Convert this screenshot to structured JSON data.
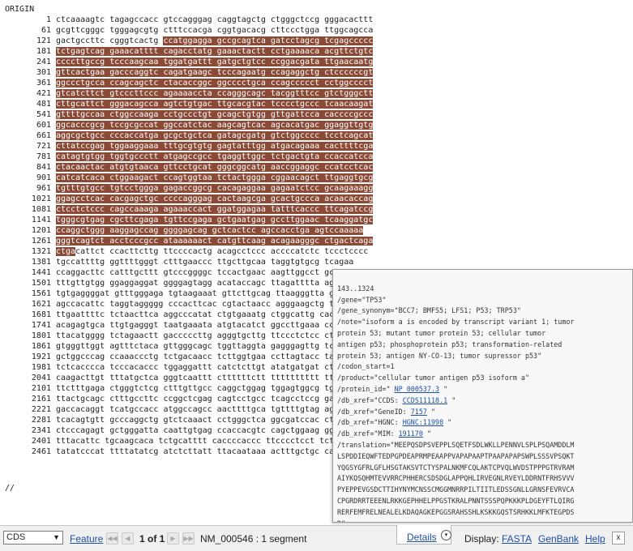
{
  "origin_label": "ORIGIN",
  "end_marker": "//",
  "sequence_lines": [
    {
      "num": "1",
      "text": "ctcaaaagtc tagagccacc gtccagggag caggtagctg ctgggctccg gggacacttt",
      "hl_start": -1,
      "hl_end": 0
    },
    {
      "num": "61",
      "text": "gcgttcgggc tgggagcgtg ctttccacga cggtgacacg cttccctgga ttggcagcca",
      "hl_start": -1,
      "hl_end": 0
    },
    {
      "num": "121",
      "text": "gactgccttc cgggtcactg ccatggagga gccgcagtca gatcctagcg tcgagccccc",
      "hl_start": 22,
      "hl_end": 65
    },
    {
      "num": "181",
      "text": "tctgagtcag gaaacatttt cagacctatg gaaactactt cctgaaaaca acgttctgtc",
      "hl_start": 0,
      "hl_end": 65
    },
    {
      "num": "241",
      "text": "ccccttgccg tcccaagcaa tggatgattt gatgctgtcc ccggacgata ttgaacaatg",
      "hl_start": 0,
      "hl_end": 65
    },
    {
      "num": "301",
      "text": "gttcactgaa gacccaggtc cagatgaagc tcccagaatg ccagaggctg ctccccccgt",
      "hl_start": 0,
      "hl_end": 65
    },
    {
      "num": "361",
      "text": "ggccctgcca ccagcagctc ctacaccggc ggcccctgca ccagccccct cctggcccct",
      "hl_start": 0,
      "hl_end": 65
    },
    {
      "num": "421",
      "text": "gtcatcttct gtcccttccc agaaaaccta ccagggcagc tacggtttcc gtctgggctt",
      "hl_start": 0,
      "hl_end": 65
    },
    {
      "num": "481",
      "text": "cttgcattct gggacagcca agtctgtgac ttgcacgtac tcccctgccc tcaacaagat",
      "hl_start": 0,
      "hl_end": 65
    },
    {
      "num": "541",
      "text": "gttttgccaa ctggccaaga cctgccctgt gcagctgtgg gttgattcca caccccgccc",
      "hl_start": 0,
      "hl_end": 65
    },
    {
      "num": "601",
      "text": "ggcacccgcg tccgcgccat ggccatctac aagcagtcac agcacatgac ggaggttgtg",
      "hl_start": 0,
      "hl_end": 65
    },
    {
      "num": "661",
      "text": "aggcgctgcc cccaccatga gcgctgctca gatagcgatg gtctggcccc tcctcagcat",
      "hl_start": 0,
      "hl_end": 65
    },
    {
      "num": "721",
      "text": "cttatccgag tggaaggaaa tttgcgtgtg gagtatttgg atgacagaaa cacttttcga",
      "hl_start": 0,
      "hl_end": 65
    },
    {
      "num": "781",
      "text": "catagtgtgg tggtgccctt atgagccgcc tgaggttggc tctgactgta ccaccatcca",
      "hl_start": 0,
      "hl_end": 65
    },
    {
      "num": "841",
      "text": "ctacaactac atgtgtaaca gttcctgcat gggcggcatg aaccggaggc ccatcctcac",
      "hl_start": 0,
      "hl_end": 65
    },
    {
      "num": "901",
      "text": "catcatcaca ctggaagact ccagtggtaa tctactggga cggaacagct ttgaggtgcg",
      "hl_start": 0,
      "hl_end": 65
    },
    {
      "num": "961",
      "text": "tgtttgtgcc tgtcctggga gagaccggcg cacagaggaa gagaatctcc gcaagaaagg",
      "hl_start": 0,
      "hl_end": 65
    },
    {
      "num": "1021",
      "text": "ggagcctcac cacgagctgc ccccagggag cactaagcga gcactgccca acaacaccag",
      "hl_start": 0,
      "hl_end": 65
    },
    {
      "num": "1081",
      "text": "ctcctctccc cagccaaaga agaaaccact ggatggagaa tatttcaccc ttcagatccg",
      "hl_start": 0,
      "hl_end": 65
    },
    {
      "num": "1141",
      "text": "tgggcgtgag cgcttcgaga tgttccgaga gctgaatgag gccttggaac tcaaggatgc",
      "hl_start": 0,
      "hl_end": 65
    },
    {
      "num": "1201",
      "text": "ccaggctggg aaggagccag ggggagcag gctcactcc agccacctga agtccaaaaa",
      "hl_start": 0,
      "hl_end": 65
    },
    {
      "num": "1261",
      "text": "gggtcagtct acctcccgcc ataaaaaact catgttcaag acagaagggc ctgactcaga",
      "hl_start": 0,
      "hl_end": 65
    },
    {
      "num": "1321",
      "text": "ctgacattct ccacttcttg ttccccactg acagcctccc accccatctc tccctcccc",
      "hl_start": 0,
      "hl_end": 4
    },
    {
      "num": "1381",
      "text": "tgccattttg ggttttgggt ctttgaaccc ttgcttgcaa taggtgtgcg tcagaa",
      "hl_start": -1,
      "hl_end": 0
    },
    {
      "num": "1441",
      "text": "ccaggacttc catttgcttt gtcccggggc tccactgaac aagttggcct gcactg",
      "hl_start": -1,
      "hl_end": 0
    },
    {
      "num": "1501",
      "text": "tttgttgtgg ggaggaggat ggggagtagg acataccagc ttagatttta aggttt",
      "hl_start": -1,
      "hl_end": 0
    },
    {
      "num": "1561",
      "text": "tgtgaggggat gtttgggaga tgtaagaaat gttcttgcag ttaagggtta gtttac",
      "hl_start": -1,
      "hl_end": 0
    },
    {
      "num": "1621",
      "text": "agccacattc taggtaggggg cccacttcac cgtactaacc agggaagctg tccctc",
      "hl_start": -1,
      "hl_end": 0
    },
    {
      "num": "1681",
      "text": "ttgaattttc tctaacttca aggcccatat ctgtgaaatg ctggcattg cacctа",
      "hl_start": -1,
      "hl_end": 0
    },
    {
      "num": "1741",
      "text": "acagagtgca ttgtgagggt taatgaaata atgtacatct ggccttgaaa ccacct",
      "hl_start": -1,
      "hl_end": 0
    },
    {
      "num": "1801",
      "text": "ttacatgggg tctagaactt gaccccсttg agggtgcttg ttccctctcc ctgttg",
      "hl_start": -1,
      "hl_end": 0
    },
    {
      "num": "1861",
      "text": "gtgggttggt agtttctaca gttgggcagc tggttaggta gagggagttg tcaagt",
      "hl_start": -1,
      "hl_end": 0
    },
    {
      "num": "1921",
      "text": "gctggcccag ccaaaccctg tctgacaacc tcttggtgaa ccttagtacc taaaag",
      "hl_start": -1,
      "hl_end": 0
    },
    {
      "num": "1981",
      "text": "tctcacccca tcccacaccc tggaggattt catctcttgt atatgatgat ctggat",
      "hl_start": -1,
      "hl_end": 0
    },
    {
      "num": "2041",
      "text": "caagacttgt tttatgctca gggtcaattt cttttttctt tttttttttt tttttt",
      "hl_start": -1,
      "hl_end": 0
    },
    {
      "num": "2101",
      "text": "ttctttgaga ctgggtctcg ctttgttgcc caggctggag tggagtggcg tgatct",
      "hl_start": -1,
      "hl_end": 0
    },
    {
      "num": "2161",
      "text": "ttactgcagc ctttgccttc ccggctcgag cagtcctgcc tcagcctccg gagtag",
      "hl_start": -1,
      "hl_end": 0
    },
    {
      "num": "2221",
      "text": "gaccacaggt tcatgccacc atggccagcc aacttttgca tgttttgtag agatgg",
      "hl_start": -1,
      "hl_end": 0
    },
    {
      "num": "2281",
      "text": "tcacagtgtt gcccaggctg gtctcaaact cctgggctca ggcgatccac ctgtct",
      "hl_start": -1,
      "hl_end": 0
    },
    {
      "num": "2341",
      "text": "ctcccagagt gctgggatta caattgtgag ccaccacgtc cagctggaag ggtcaa",
      "hl_start": -1,
      "hl_end": 0
    },
    {
      "num": "2401",
      "text": "tttacattc tgcaagcaca tctgcatttt caccccaccc ttcccctcct tctccc",
      "hl_start": -1,
      "hl_end": 0
    },
    {
      "num": "2461",
      "text": "tatatcccat ttttatatcg atctcttatt ttacaataaa actttgctgc ca",
      "hl_start": -1,
      "hl_end": 0
    }
  ],
  "popup": {
    "range": "143..1324",
    "gene": "/gene=\"TP53\"",
    "gene_synonym": "/gene_synonym=\"BCC7; BMFS5; LFS1; P53; TRP53\"",
    "note_lines": [
      "/note=\"isoform a is encoded by transcript variant 1; tumor",
      "protein 53; mutant tumor protein 53; cellular tumor",
      "antigen p53; phosphoprotein p53; transformation-related",
      "protein 53; antigen NY-CO-13; tumor supressor p53\""
    ],
    "codon_start": "/codon_start=1",
    "product": "/product=\"cellular tumor antigen p53 isoform a\"",
    "protein_id_prefix": "/protein_id=\"",
    "protein_id": "NP_000537.3",
    "db_xref_ccds_prefix": "/db_xref=\"CCDS:",
    "ccds": "CCDS11118.1",
    "db_xref_gene_prefix": "/db_xref=\"GeneID:",
    "gene_id": "7157",
    "db_xref_hgnc_prefix": "/db_xref=\"HGNC:",
    "hgnc": "HGNC:11998",
    "db_xref_mim_prefix": "/db_xref=\"MIM:",
    "mim": "191170",
    "quote_close": " \"",
    "translation_lines": [
      "/translation=\"MEEPQSDPSVEPPLSQETFSDLWKLLPENNVLSPLPSQAMDDLM",
      "LSPDDIEQWFTEDPGPDEAPRMPEAAPPVAPAPAAPTPAAPAPAPSWPLSSSVPSQKT",
      "YQGSYGFRLGFLHSGTAKSVTCTYSPALNKMFCQLAKTCPVQLWVDSTPPPGTRVRAM",
      "AIYKQSQHMTEVVRRCPHHERCSDSDGLAPPQHLIRVEGNLRVEYLDDRNTFRHSVVV",
      "PYEPPEVGSDCTTIHYNYMCNSSCMGGMNRRPILTIITLEDSSGNLLGRNSFEVRVCA",
      "CPGRDRRTEEENLRKKGEPHHELPPGSTKRALPNNTSSSPQPKKKPLDGEYFTLQIRG",
      "RERFEMFRELNEALELKDAQAGKEPGGSRAHSSHLKSKKGQSTSRHKKLMFKTEGPDS",
      "D\""
    ]
  },
  "bottom_bar": {
    "feature_select": "CDS",
    "feature_link": "Feature",
    "first_icon": "first-page-icon",
    "prev_icon": "prev-page-icon",
    "page_info": "1 of 1",
    "next_icon": "next-page-icon",
    "last_icon": "last-page-icon",
    "accession": "NM_000546 : 1 segment",
    "details_label": "Details",
    "details_icon": "chevron-down-circle-icon",
    "display_label": "Display:",
    "fasta": "FASTA",
    "genbank": "GenBank",
    "help": "Help",
    "close": "x"
  }
}
